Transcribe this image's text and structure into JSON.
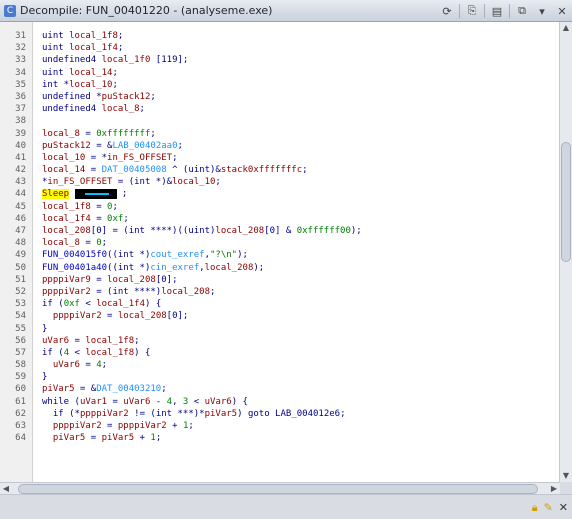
{
  "window": {
    "title": "Decompile: FUN_00401220 - (analyseme.exe)",
    "title_icon": "decompiler-icon"
  },
  "toolbar": {
    "buttons": [
      {
        "name": "refresh-icon",
        "glyph": "⟳"
      },
      {
        "name": "copy-icon",
        "glyph": "⎘"
      },
      {
        "name": "export-icon",
        "glyph": "▤"
      },
      {
        "name": "snapshot-icon",
        "glyph": "⧉"
      },
      {
        "name": "menu-dropdown-icon",
        "glyph": "▾"
      },
      {
        "name": "close-icon",
        "glyph": "✕"
      }
    ]
  },
  "code": {
    "lines": [
      {
        "n": "31",
        "html": "<span class=\"kw\">uint</span> <span class=\"loc\">local_1f8</span>;"
      },
      {
        "n": "32",
        "html": "<span class=\"kw\">uint</span> <span class=\"loc\">local_1f4</span>;"
      },
      {
        "n": "33",
        "html": "<span class=\"kw\">undefined4</span> <span class=\"loc\">local_1f0</span> [119];"
      },
      {
        "n": "34",
        "html": "<span class=\"kw\">uint</span> <span class=\"loc\">local_14</span>;"
      },
      {
        "n": "35",
        "html": "<span class=\"kw\">int</span> *<span class=\"loc\">local_10</span>;"
      },
      {
        "n": "36",
        "html": "<span class=\"kw\">undefined</span> *<span class=\"loc\">puStack12</span>;"
      },
      {
        "n": "37",
        "html": "<span class=\"kw\">undefined4</span> <span class=\"loc\">local_8</span>;"
      },
      {
        "n": "38",
        "html": ""
      },
      {
        "n": "39",
        "html": "<span class=\"loc\">local_8</span> = <span class=\"num\">0xffffffff</span>;"
      },
      {
        "n": "40",
        "html": "<span class=\"loc\">puStack12</span> = &amp;<span class=\"sym\">LAB_00402aa0</span>;"
      },
      {
        "n": "41",
        "html": "<span class=\"loc\">local_10</span> = *<span class=\"loc\">in_FS_OFFSET</span>;"
      },
      {
        "n": "42",
        "html": "<span class=\"loc\">local_14</span> = <span class=\"sym\">DAT_00405008</span> ^ (uint)&amp;<span class=\"loc\">stack0xfffffffc</span>;"
      },
      {
        "n": "43",
        "html": "*<span class=\"loc\">in_FS_OFFSET</span> = (int *)&amp;<span class=\"loc\">local_10</span>;"
      },
      {
        "n": "44",
        "html": "<span class=\"highlight\">Sleep</span> <span class=\"redact\"></span> ;"
      },
      {
        "n": "45",
        "html": "<span class=\"loc\">local_1f8</span> = <span class=\"num\">0</span>;"
      },
      {
        "n": "46",
        "html": "<span class=\"loc\">local_1f4</span> = <span class=\"num\">0xf</span>;"
      },
      {
        "n": "47",
        "html": "<span class=\"loc\">local_208</span>[0] = (int ****)((uint)<span class=\"loc\">local_208</span>[0] &amp; <span class=\"num\">0xffffff00</span>);"
      },
      {
        "n": "48",
        "html": "<span class=\"loc\">local_8</span> = <span class=\"num\">0</span>;"
      },
      {
        "n": "49",
        "html": "<span class=\"fn\">FUN_004015f0</span>((int *)<span class=\"sym\">cout_exref</span>,<span class=\"str\">\"?\\n\"</span>);"
      },
      {
        "n": "50",
        "html": "<span class=\"fn\">FUN_00401a40</span>((int *)<span class=\"sym\">cin_exref</span>,<span class=\"loc\">local_208</span>);"
      },
      {
        "n": "51",
        "html": "<span class=\"loc\">ppppiVar9</span> = <span class=\"loc\">local_208</span>[0];"
      },
      {
        "n": "52",
        "html": "<span class=\"loc\">ppppiVar2</span> = (int ****)<span class=\"loc\">local_208</span>;"
      },
      {
        "n": "53",
        "html": "<span class=\"kw\">if</span> (<span class=\"num\">0xf</span> &lt; <span class=\"loc\">local_1f4</span>) {"
      },
      {
        "n": "54",
        "html": "  <span class=\"loc\">ppppiVar2</span> = <span class=\"loc\">local_208</span>[0];"
      },
      {
        "n": "55",
        "html": "}"
      },
      {
        "n": "56",
        "html": "<span class=\"loc\">uVar6</span> = <span class=\"loc\">local_1f8</span>;"
      },
      {
        "n": "57",
        "html": "<span class=\"kw\">if</span> (<span class=\"num\">4</span> &lt; <span class=\"loc\">local_1f8</span>) {"
      },
      {
        "n": "58",
        "html": "  <span class=\"loc\">uVar6</span> = <span class=\"num\">4</span>;"
      },
      {
        "n": "59",
        "html": "}"
      },
      {
        "n": "60",
        "html": "<span class=\"loc\">piVar5</span> = &amp;<span class=\"sym\">DAT_00403210</span>;"
      },
      {
        "n": "61",
        "html": "<span class=\"kw\">while</span> (<span class=\"loc\">uVar1</span> = <span class=\"loc\">uVar6</span> - <span class=\"num\">4</span>, <span class=\"num\">3</span> &lt; <span class=\"loc\">uVar6</span>) {"
      },
      {
        "n": "62",
        "html": "  <span class=\"kw\">if</span> (*<span class=\"loc\">ppppiVar2</span> != (int ***)*<span class=\"loc\">piVar5</span>) <span class=\"kw\">goto</span> LAB_004012e6;"
      },
      {
        "n": "63",
        "html": "  <span class=\"loc\">ppppiVar2</span> = <span class=\"loc\">ppppiVar2</span> + <span class=\"num\">1</span>;"
      },
      {
        "n": "64",
        "html": "  <span class=\"loc\">piVar5</span> = <span class=\"loc\">piVar5</span> + <span class=\"num\">1</span>;"
      }
    ]
  },
  "status": {
    "icons": [
      "lock-icon",
      "edit-icon",
      "close-icon"
    ]
  }
}
